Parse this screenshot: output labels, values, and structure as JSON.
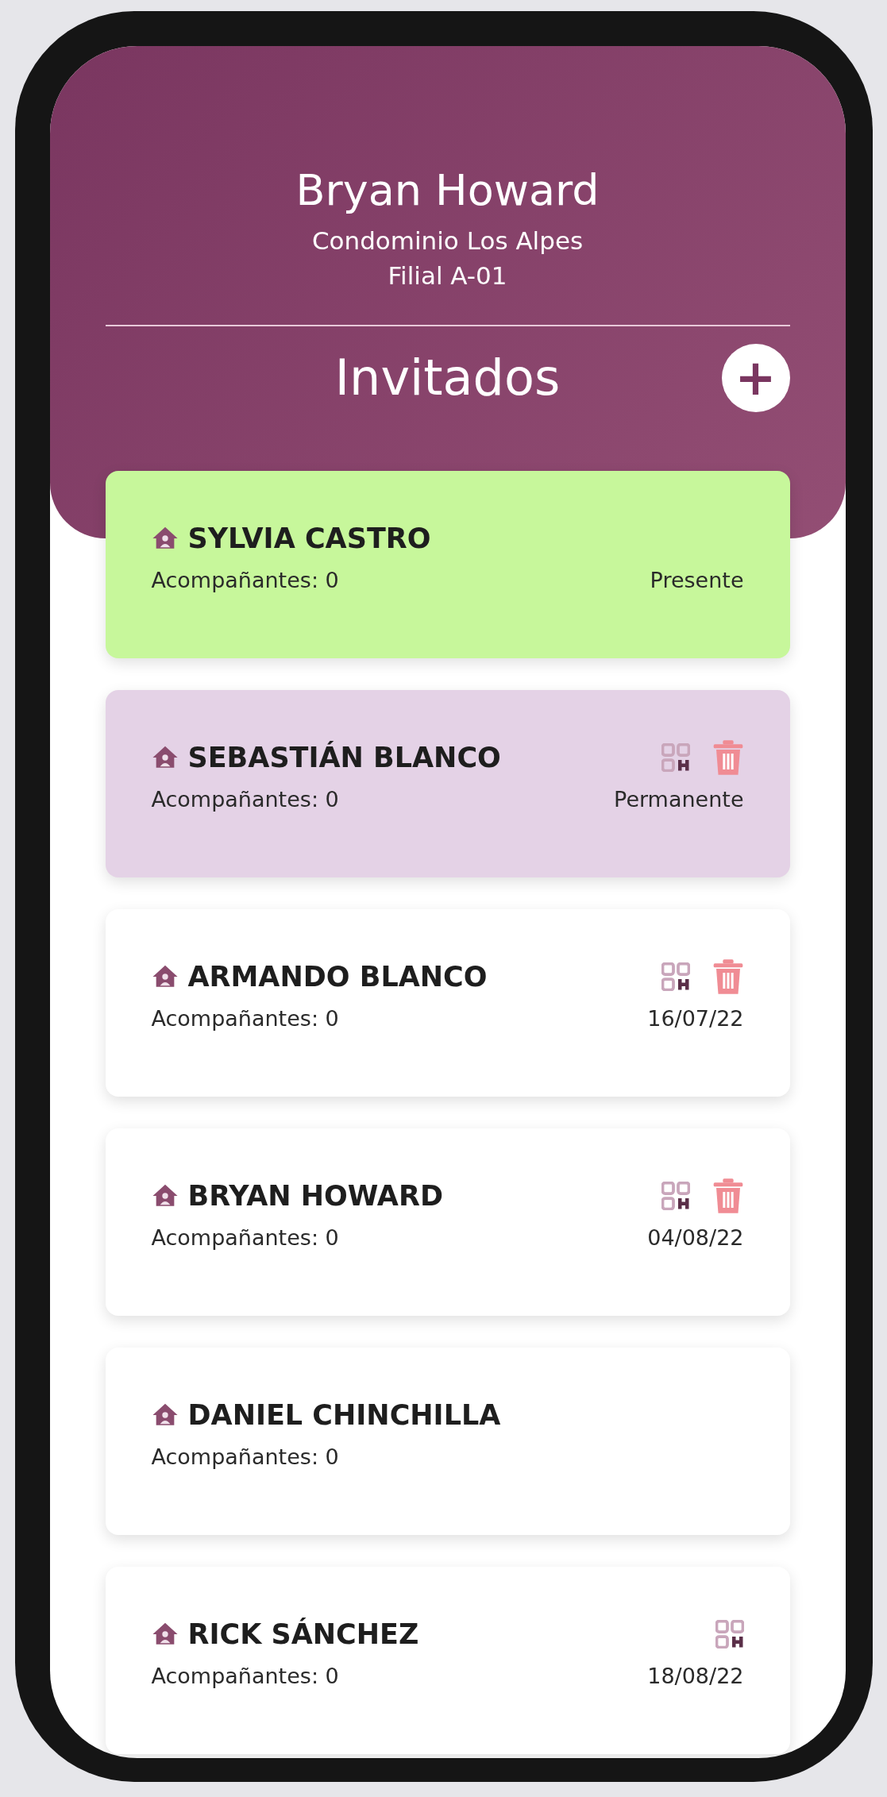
{
  "profile": {
    "name": "Bryan Howard",
    "condominium": "Condominio Los Alpes",
    "unit": "Filial A-01"
  },
  "section": {
    "title": "Invitados",
    "add_button": "+"
  },
  "guests": [
    {
      "name": "SYLVIA CASTRO",
      "companions": "Acompañantes: 0",
      "status": "Presente",
      "kind": "present",
      "qr": false,
      "delete": false
    },
    {
      "name": "SEBASTIÁN BLANCO",
      "companions": "Acompañantes: 0",
      "status": "Permanente",
      "kind": "permanent",
      "qr": true,
      "delete": true
    },
    {
      "name": "ARMANDO BLANCO",
      "companions": "Acompañantes: 0",
      "status": "16/07/22",
      "kind": "dated",
      "qr": true,
      "delete": true
    },
    {
      "name": "BRYAN HOWARD",
      "companions": "Acompañantes: 0",
      "status": "04/08/22",
      "kind": "dated",
      "qr": true,
      "delete": true
    },
    {
      "name": "DANIEL CHINCHILLA",
      "companions": "Acompañantes: 0",
      "kind": "dated",
      "qr": false,
      "delete": false
    },
    {
      "name": "RICK SÁNCHEZ",
      "companions": "Acompañantes: 0",
      "status": "18/08/22",
      "kind": "dated",
      "qr": true,
      "delete": false
    }
  ]
}
